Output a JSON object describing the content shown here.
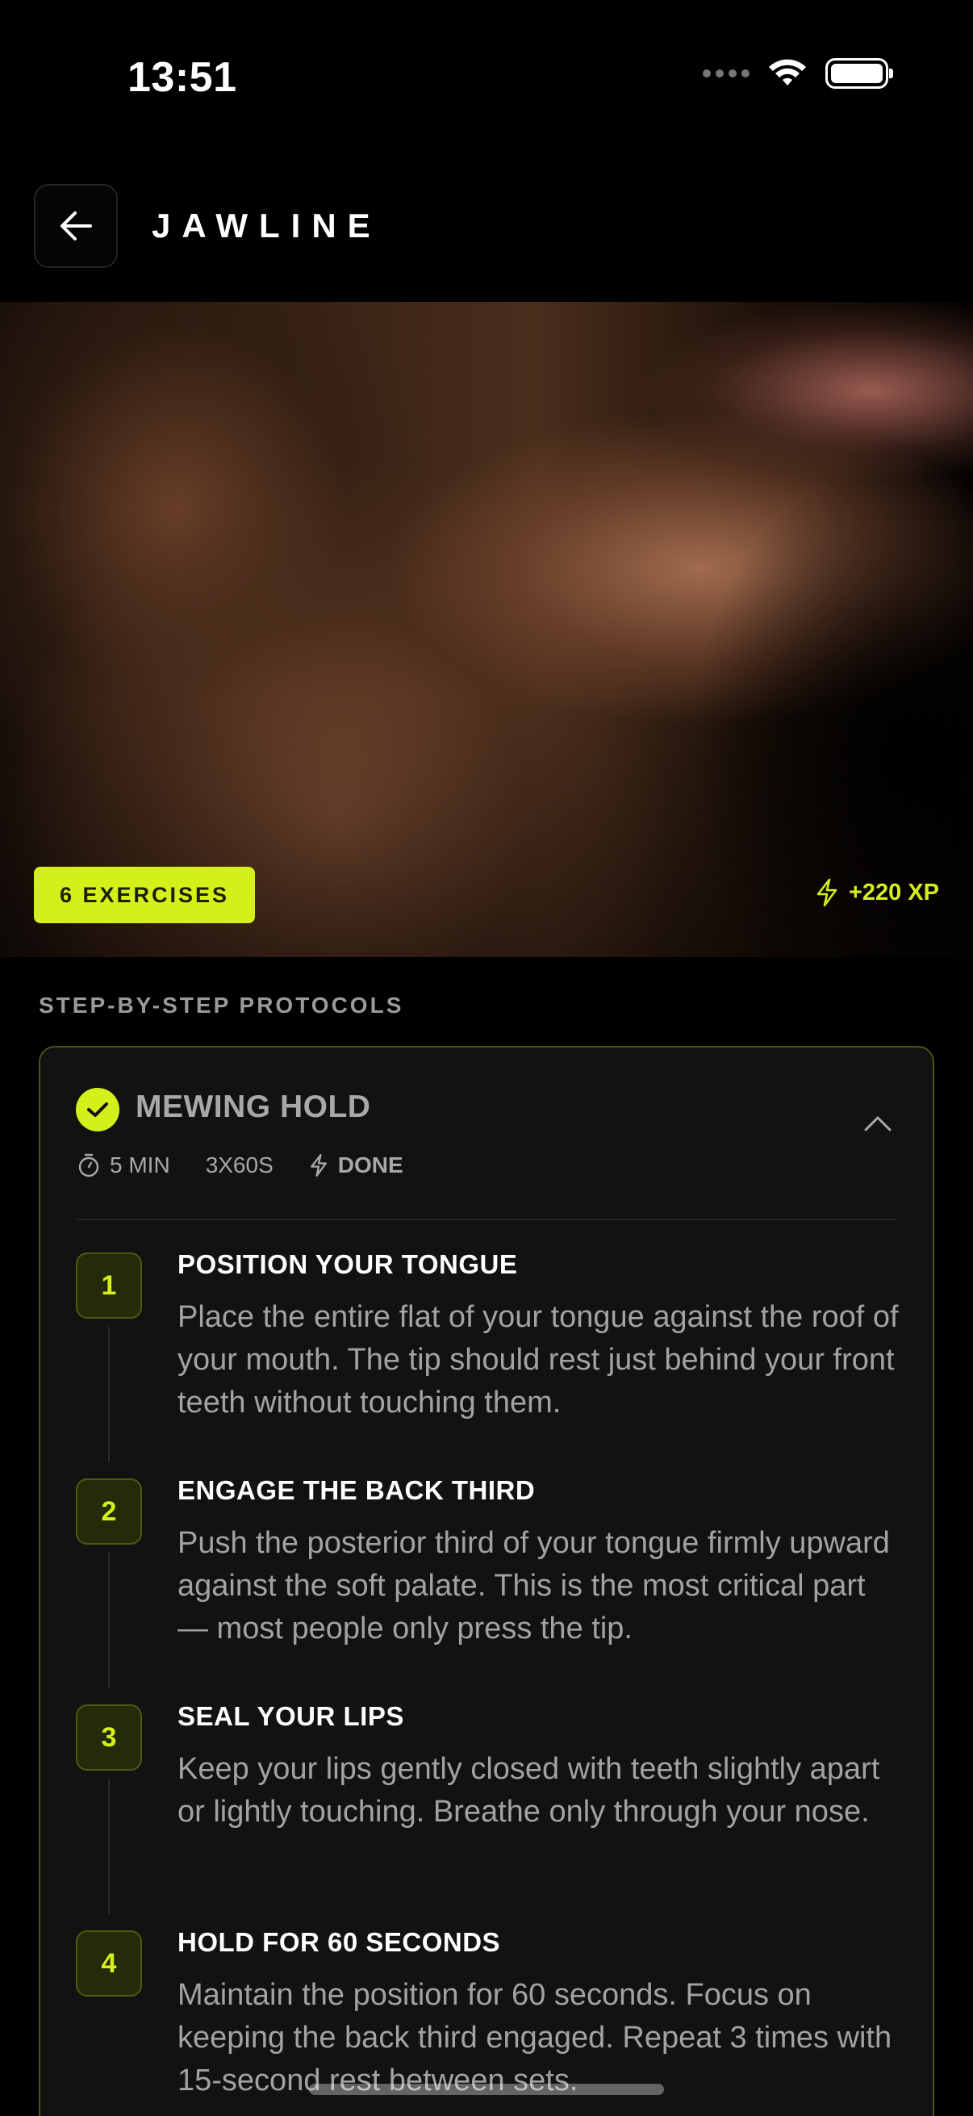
{
  "status_bar": {
    "time": "13:51"
  },
  "header": {
    "title": "JAWLINE"
  },
  "hero": {
    "exercise_count": "6 EXERCISES",
    "xp": "+220 XP"
  },
  "section_label": "STEP-BY-STEP PROTOCOLS",
  "exercise": {
    "title": "MEWING HOLD",
    "duration": "5 MIN",
    "sets": "3X60S",
    "status": "DONE",
    "steps": [
      {
        "number": "1",
        "title": "POSITION YOUR TONGUE",
        "body": "Place the entire flat of your tongue against the roof of your mouth. The tip should rest just behind your front teeth without touching them."
      },
      {
        "number": "2",
        "title": "ENGAGE THE BACK THIRD",
        "body": "Push the posterior third of your tongue firmly upward against the soft palate. This is the most critical part — most people only press the tip."
      },
      {
        "number": "3",
        "title": "SEAL YOUR LIPS",
        "body": "Keep your lips gently closed with teeth slightly apart or lightly touching. Breathe only through your nose."
      },
      {
        "number": "4",
        "title": "HOLD FOR 60 SECONDS",
        "body": "Maintain the position for 60 seconds. Focus on keeping the back third engaged. Repeat 3 times with 15-second rest between sets."
      }
    ]
  },
  "colors": {
    "accent": "#d4f01a",
    "background": "#000000",
    "card": "#121212"
  }
}
